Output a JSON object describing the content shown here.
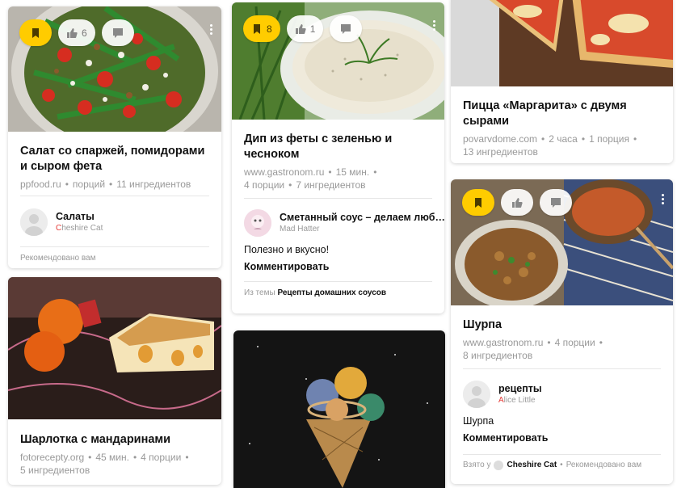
{
  "cards": {
    "salad": {
      "likes": "6",
      "title": "Салат со спаржей, помидорами и сыром фета",
      "source": "ppfood.ru",
      "portions": "порций",
      "ingredients": "11 ингредиентов",
      "channel": "Салаты",
      "channel_owner": "Cheshire Cat",
      "recommended": "Рекомендовано вам"
    },
    "dip": {
      "saves": "8",
      "likes": "1",
      "title": "Дип из феты с зеленью и чесноком",
      "source": "www.gastronom.ru",
      "time": "15 мин.",
      "portions": "4 порции",
      "ingredients": "7 ингредиентов",
      "channel": "Сметанный соус – делаем люб…",
      "channel_owner": "Mad Hatter",
      "note": "Полезно и вкусно!",
      "comment": "Комментировать",
      "topic_prefix": "Из темы",
      "topic": "Рецепты домашних соусов"
    },
    "pizza": {
      "title": "Пицца «Маргарита» с двумя сырами",
      "source": "povarvdome.com",
      "time": "2 часа",
      "portions": "1 порция",
      "ingredients": "13 ингредиентов"
    },
    "shurpa": {
      "title": "Шурпа",
      "source": "www.gastronom.ru",
      "portions": "4 порции",
      "ingredients": "8 ингредиентов",
      "channel": "рецепты",
      "channel_owner": "Alice Little",
      "note": "Шурпа",
      "comment": "Комментировать",
      "taken_prefix": "Взято у",
      "taken_from": "Cheshire Cat",
      "recommended": "Рекомендовано вам"
    },
    "charlotte": {
      "title": "Шарлотка с мандаринами",
      "source": "fotorecepty.org",
      "time": "45 мин.",
      "portions": "4 порции",
      "ingredients": "5 ингредиентов"
    }
  },
  "colors": {
    "accent_yellow": "#ffcc00",
    "owner_red": "#e53935",
    "meta_gray": "#999999"
  },
  "icons": [
    "bookmark-icon",
    "thumbs-up-icon",
    "comment-icon",
    "more-dots-icon"
  ]
}
